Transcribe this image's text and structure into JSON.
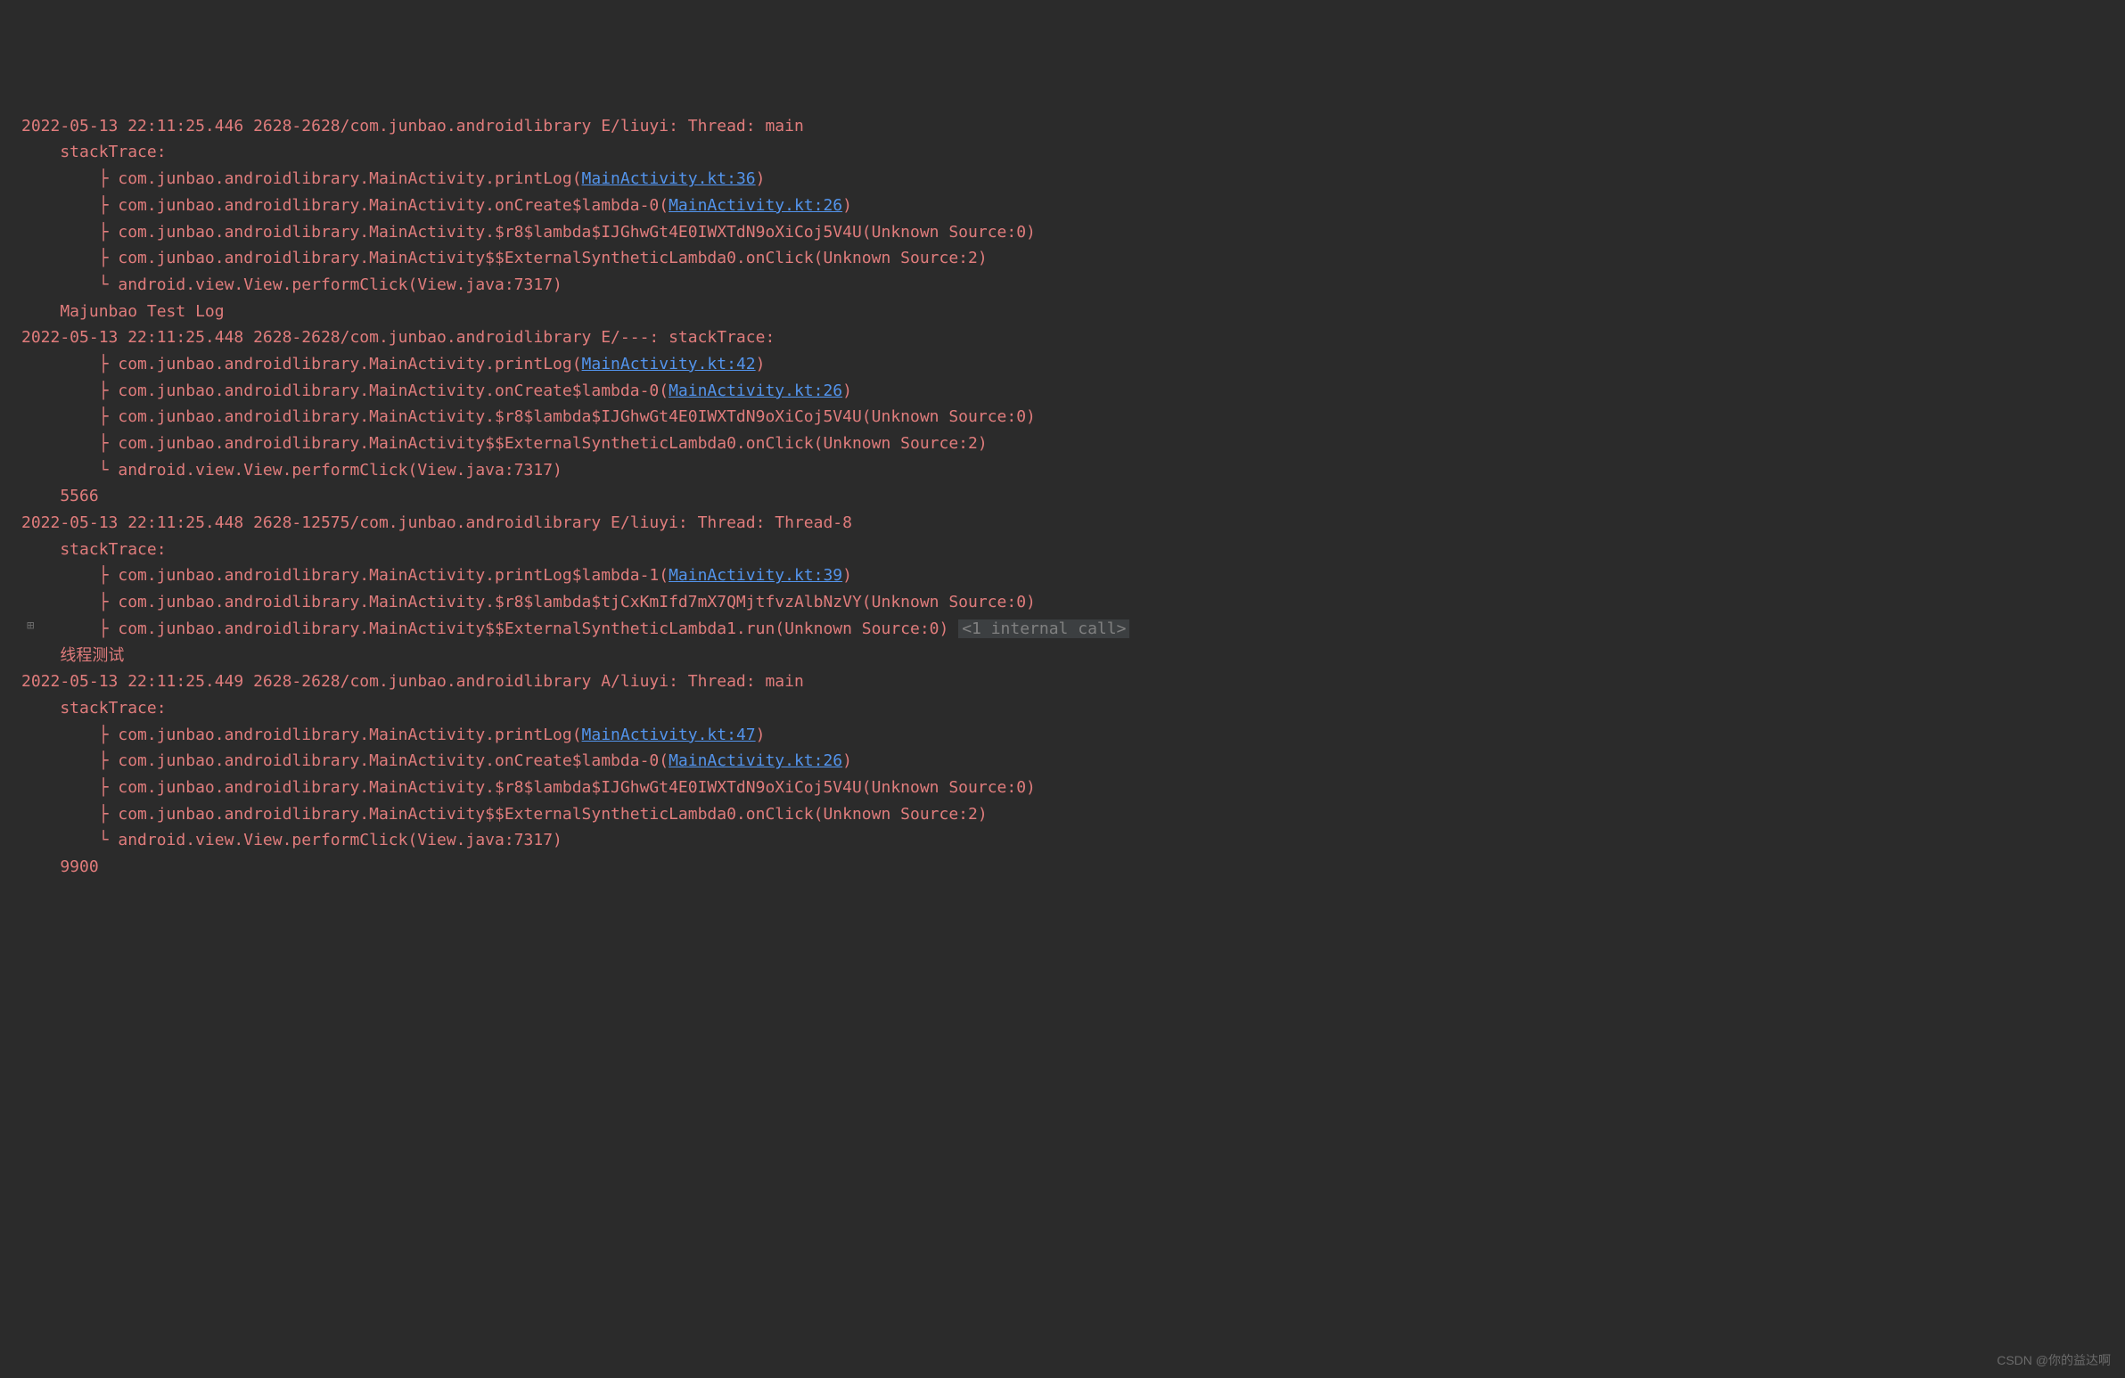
{
  "logs": [
    {
      "header": "2022-05-13 22:11:25.446 2628-2628/com.junbao.androidlibrary E/liuyi: Thread: main",
      "stackTraceLabel": "    stackTrace:",
      "frames": [
        {
          "prefix": "        ├ com.junbao.androidlibrary.MainActivity.printLog(",
          "link": "MainActivity.kt:36",
          "suffix": ")"
        },
        {
          "prefix": "        ├ com.junbao.androidlibrary.MainActivity.onCreate$lambda-0(",
          "link": "MainActivity.kt:26",
          "suffix": ")"
        },
        {
          "prefix": "        ├ com.junbao.androidlibrary.MainActivity.$r8$lambda$IJGhwGt4E0IWXTdN9oXiCoj5V4U(Unknown Source:0)",
          "link": "",
          "suffix": ""
        },
        {
          "prefix": "        ├ com.junbao.androidlibrary.MainActivity$$ExternalSyntheticLambda0.onClick(Unknown Source:2)",
          "link": "",
          "suffix": ""
        },
        {
          "prefix": "        └ android.view.View.performClick(View.java:7317)",
          "link": "",
          "suffix": ""
        }
      ],
      "message": "    Majunbao Test Log"
    },
    {
      "header": "2022-05-13 22:11:25.448 2628-2628/com.junbao.androidlibrary E/---: stackTrace:",
      "stackTraceLabel": "",
      "frames": [
        {
          "prefix": "        ├ com.junbao.androidlibrary.MainActivity.printLog(",
          "link": "MainActivity.kt:42",
          "suffix": ")"
        },
        {
          "prefix": "        ├ com.junbao.androidlibrary.MainActivity.onCreate$lambda-0(",
          "link": "MainActivity.kt:26",
          "suffix": ")"
        },
        {
          "prefix": "        ├ com.junbao.androidlibrary.MainActivity.$r8$lambda$IJGhwGt4E0IWXTdN9oXiCoj5V4U(Unknown Source:0)",
          "link": "",
          "suffix": ""
        },
        {
          "prefix": "        ├ com.junbao.androidlibrary.MainActivity$$ExternalSyntheticLambda0.onClick(Unknown Source:2)",
          "link": "",
          "suffix": ""
        },
        {
          "prefix": "        └ android.view.View.performClick(View.java:7317)",
          "link": "",
          "suffix": ""
        }
      ],
      "message": "    5566"
    },
    {
      "header": "2022-05-13 22:11:25.448 2628-12575/com.junbao.androidlibrary E/liuyi: Thread: Thread-8",
      "stackTraceLabel": "    stackTrace:",
      "frames": [
        {
          "prefix": "        ├ com.junbao.androidlibrary.MainActivity.printLog$lambda-1(",
          "link": "MainActivity.kt:39",
          "suffix": ")"
        },
        {
          "prefix": "        ├ com.junbao.androidlibrary.MainActivity.$r8$lambda$tjCxKmIfd7mX7QMjtfvzAlbNzVY(Unknown Source:0)",
          "link": "",
          "suffix": ""
        },
        {
          "prefix": "        ├ com.junbao.androidlibrary.MainActivity$$ExternalSyntheticLambda1.run(Unknown Source:0) ",
          "link": "",
          "suffix": "",
          "internal": "<1 internal call>",
          "expandable": true
        }
      ],
      "message": "    线程测试"
    },
    {
      "header": "2022-05-13 22:11:25.449 2628-2628/com.junbao.androidlibrary A/liuyi: Thread: main",
      "stackTraceLabel": "    stackTrace:",
      "frames": [
        {
          "prefix": "        ├ com.junbao.androidlibrary.MainActivity.printLog(",
          "link": "MainActivity.kt:47",
          "suffix": ")"
        },
        {
          "prefix": "        ├ com.junbao.androidlibrary.MainActivity.onCreate$lambda-0(",
          "link": "MainActivity.kt:26",
          "suffix": ")"
        },
        {
          "prefix": "        ├ com.junbao.androidlibrary.MainActivity.$r8$lambda$IJGhwGt4E0IWXTdN9oXiCoj5V4U(Unknown Source:0)",
          "link": "",
          "suffix": ""
        },
        {
          "prefix": "        ├ com.junbao.androidlibrary.MainActivity$$ExternalSyntheticLambda0.onClick(Unknown Source:2)",
          "link": "",
          "suffix": ""
        },
        {
          "prefix": "        └ android.view.View.performClick(View.java:7317)",
          "link": "",
          "suffix": ""
        }
      ],
      "message": "    9900"
    }
  ],
  "watermark": "CSDN @你的益达啊"
}
